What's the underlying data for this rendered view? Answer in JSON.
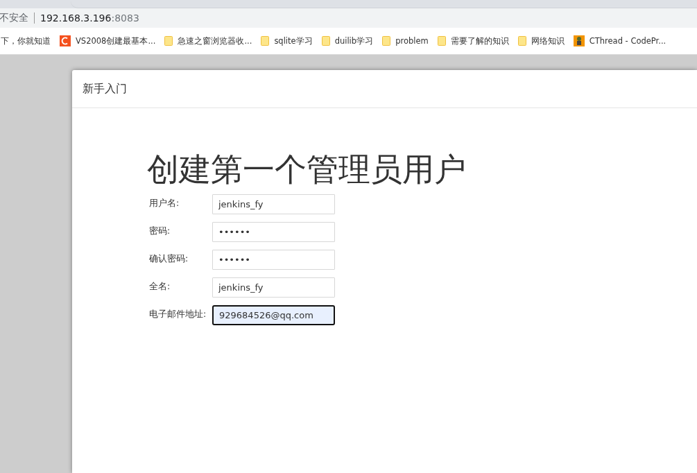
{
  "browser": {
    "security_label": "不安全",
    "address_host": "192.168.3.196",
    "address_port": ":8083",
    "bookmarks": [
      {
        "kind": "none",
        "label": "下，你就知道"
      },
      {
        "kind": "logo",
        "label": "VS2008创建最基本..."
      },
      {
        "kind": "folder",
        "label": "急速之窗浏览器收..."
      },
      {
        "kind": "folder",
        "label": "sqlite学习"
      },
      {
        "kind": "folder",
        "label": "duilib学习"
      },
      {
        "kind": "folder",
        "label": "problem"
      },
      {
        "kind": "folder",
        "label": "需要了解的知识"
      },
      {
        "kind": "folder",
        "label": "网络知识"
      },
      {
        "kind": "robot",
        "label": "CThread - CodePr..."
      }
    ]
  },
  "dialog": {
    "title": "新手入门",
    "heading": "创建第一个管理员用户",
    "fields": [
      {
        "label": "用户名:",
        "value": "jenkins_fy",
        "focused": false
      },
      {
        "label": "密码:",
        "value": "••••••",
        "focused": false
      },
      {
        "label": "确认密码:",
        "value": "••••••",
        "focused": false
      },
      {
        "label": "全名:",
        "value": "jenkins_fy",
        "focused": false
      },
      {
        "label": "电子邮件地址:",
        "value": "929684526@qq.com",
        "focused": true
      }
    ]
  }
}
